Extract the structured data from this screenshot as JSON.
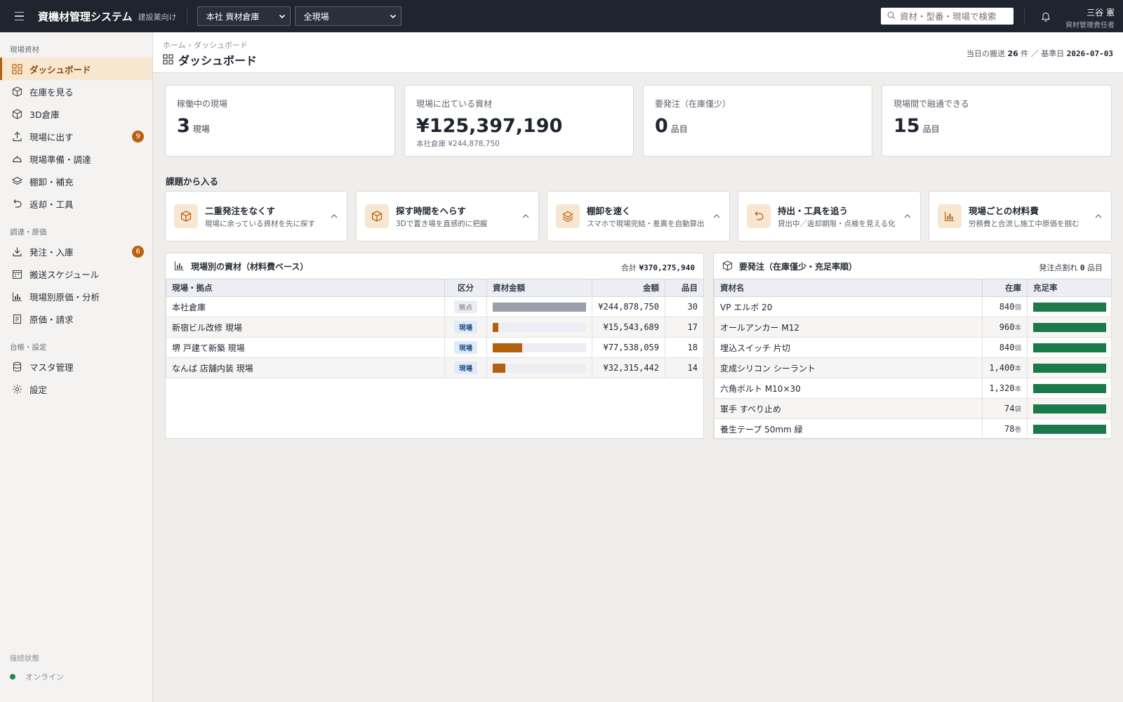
{
  "app": {
    "title": "資機材管理システム",
    "subtitle": "建設業向け",
    "warehouse_select": "本社 資材倉庫",
    "site_select": "全現場",
    "search_placeholder": "資材・型番・現場で検索",
    "user_name": "三谷 憲",
    "user_role": "資材管理責任者"
  },
  "sidebar": {
    "sections": [
      {
        "label": "現場資材",
        "items": [
          {
            "label": "ダッシュボード",
            "icon": "dashboard-icon",
            "active": true
          },
          {
            "label": "在庫を見る",
            "icon": "cube-icon"
          },
          {
            "label": "3D倉庫",
            "icon": "cube-3d-icon"
          },
          {
            "label": "現場に出す",
            "icon": "upload-icon",
            "badge": "9"
          },
          {
            "label": "現場準備・調達",
            "icon": "helmet-icon"
          },
          {
            "label": "棚卸・補充",
            "icon": "layers-icon"
          },
          {
            "label": "返却・工具",
            "icon": "undo-icon"
          }
        ]
      },
      {
        "label": "調達・原価",
        "items": [
          {
            "label": "発注・入庫",
            "icon": "download-icon",
            "badge": "6"
          },
          {
            "label": "搬送スケジュール",
            "icon": "calendar-icon"
          },
          {
            "label": "現場別原価・分析",
            "icon": "chart-icon"
          },
          {
            "label": "原価・請求",
            "icon": "document-icon"
          }
        ]
      },
      {
        "label": "台帳・設定",
        "items": [
          {
            "label": "マスタ管理",
            "icon": "database-icon"
          },
          {
            "label": "設定",
            "icon": "gear-icon"
          }
        ]
      }
    ],
    "connection_label": "接続状態",
    "connection_status": "オンライン",
    "colors": {
      "accent": "#b5600f",
      "active_bg": "#f7e6d0",
      "online": "#1f8a4c"
    }
  },
  "header": {
    "breadcrumb": "ホーム › ダッシュボード",
    "title": "ダッシュボード",
    "today_prefix": "当日の搬送",
    "today_count": "26",
    "today_mid": "件 ／ 基準日",
    "base_date": "2026-07-03"
  },
  "kpis": [
    {
      "label": "稼働中の現場",
      "value": "3",
      "unit": "現場",
      "sub": ""
    },
    {
      "label": "現場に出ている資材",
      "value": "¥125,397,190",
      "unit": "",
      "sub": "本社倉庫 ¥244,878,750"
    },
    {
      "label": "要発注（在庫僅少）",
      "value": "0",
      "unit": "品目",
      "sub": ""
    },
    {
      "label": "現場間で融通できる",
      "value": "15",
      "unit": "品目",
      "sub": ""
    }
  ],
  "tasks_title": "課題から入る",
  "tasks": [
    {
      "title": "二重発注をなくす",
      "desc": "現場に余っている資材を先に探す",
      "icon": "box-icon"
    },
    {
      "title": "探す時間をへらす",
      "desc": "3Dで置き場を直感的に把握",
      "icon": "box-icon"
    },
    {
      "title": "棚卸を速く",
      "desc": "スマホで現場完結・差異を自動算出",
      "icon": "layers-icon"
    },
    {
      "title": "持出・工具を追う",
      "desc": "貸出中／返却期限・点検を見える化",
      "icon": "undo-icon"
    },
    {
      "title": "現場ごとの材料費",
      "desc": "労務費と合流し施工中原価を掴む",
      "icon": "chart-icon"
    }
  ],
  "sites_panel": {
    "title": "現場別の資材（材料費ベース）",
    "total_label": "合計",
    "total": "¥370,275,940",
    "columns": [
      "現場・拠点",
      "区分",
      "資材金額",
      "金額",
      "品目"
    ],
    "rows": [
      {
        "name": "本社倉庫",
        "type": "拠点",
        "kind": "base",
        "share": 1.0,
        "amount": "¥244,878,750",
        "items": "30"
      },
      {
        "name": "新宿ビル改修 現場",
        "type": "現場",
        "kind": "site",
        "share": 0.0635,
        "amount": "¥15,543,689",
        "items": "17"
      },
      {
        "name": "堺 戸建て新築 現場",
        "type": "現場",
        "kind": "site",
        "share": 0.3166,
        "amount": "¥77,538,059",
        "items": "18"
      },
      {
        "name": "なんば 店舗内装 現場",
        "type": "現場",
        "kind": "site",
        "share": 0.132,
        "amount": "¥32,315,442",
        "items": "14"
      }
    ],
    "colors": {
      "base_bar": "#9aa0aa",
      "site_bar": "#b5600f"
    }
  },
  "order_panel": {
    "title": "要発注（在庫僅少・充足率順）",
    "right_label": "発注点割れ",
    "right_count": "0",
    "right_unit": "品目",
    "columns": [
      "資材名",
      "在庫",
      "充足率"
    ],
    "rows": [
      {
        "name": "VP エルボ 20",
        "stock": "840",
        "unit": "個",
        "fill": 1.0
      },
      {
        "name": "オールアンカー M12",
        "stock": "960",
        "unit": "本",
        "fill": 1.0
      },
      {
        "name": "埋込スイッチ 片切",
        "stock": "840",
        "unit": "個",
        "fill": 1.0
      },
      {
        "name": "変成シリコン シーラント",
        "stock": "1,400",
        "unit": "本",
        "fill": 1.0
      },
      {
        "name": "六角ボルト M10×30",
        "stock": "1,320",
        "unit": "本",
        "fill": 1.0
      },
      {
        "name": "軍手 すべり止め",
        "stock": "74",
        "unit": "袋",
        "fill": 1.0
      },
      {
        "name": "養生テープ 50mm 緑",
        "stock": "78",
        "unit": "巻",
        "fill": 1.0
      }
    ],
    "colors": {
      "fill_bar": "#1b7a4a"
    }
  }
}
